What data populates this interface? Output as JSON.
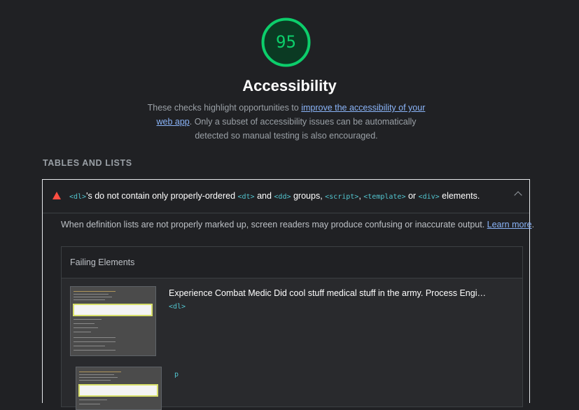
{
  "category": {
    "score": "95",
    "title": "Accessibility",
    "description_pre": "These checks highlight opportunities to ",
    "description_link": "improve the accessibility of your web app",
    "description_post": ". Only a subset of accessibility issues can be automatically detected so manual testing is also encouraged.",
    "score_color": "#0cce6b"
  },
  "group": {
    "title": "TABLES AND LISTS"
  },
  "audit": {
    "status": "fail",
    "title_parts": {
      "dl": "<dl>",
      "t1": "'s do not contain only properly-ordered ",
      "dt": "<dt>",
      "t2": " and ",
      "dd": "<dd>",
      "t3": " groups, ",
      "script": "<script>",
      "t4": ", ",
      "template": "<template>",
      "t5": " or ",
      "div": "<div>",
      "t6": " elements."
    },
    "description": "When definition lists are not properly marked up, screen readers may produce confusing or inaccurate output. ",
    "learn_more": "Learn more",
    "learn_more_suffix": "."
  },
  "table": {
    "header": "Failing Elements",
    "rows": [
      {
        "snippet": "Experience Combat Medic Did cool stuff medical stuff in the army. Process Engi…",
        "selector": "<dl>"
      },
      {
        "snippet": "",
        "selector": "p"
      }
    ]
  },
  "colors": {
    "fail": "#ff4e42",
    "link": "#8ab4f8",
    "code": "#52c5cf"
  }
}
